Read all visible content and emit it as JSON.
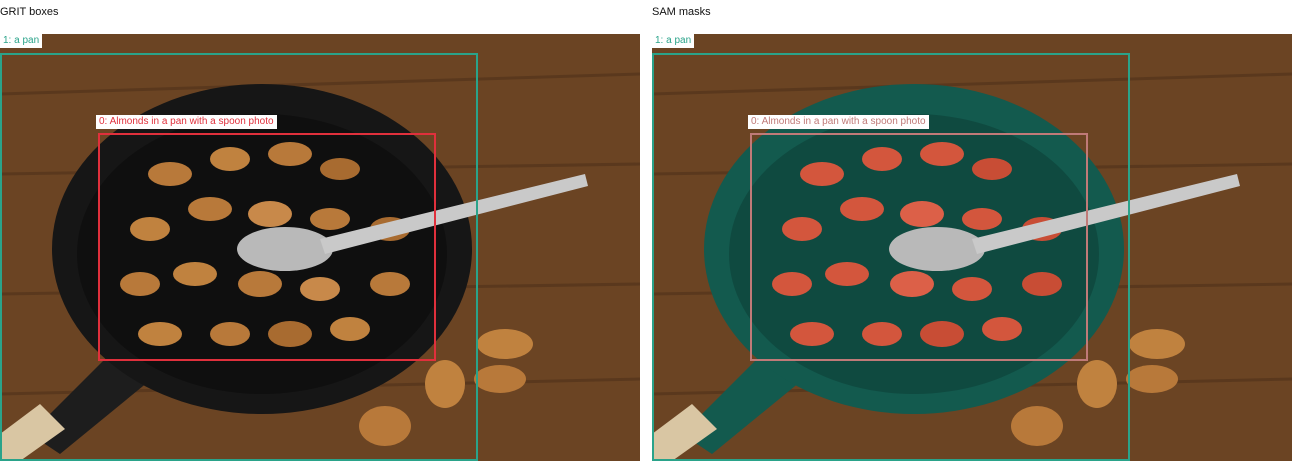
{
  "panels": [
    {
      "title": "GRIT boxes",
      "mode": "boxes",
      "annotations": [
        {
          "label": "0: Almonds in a pan with a spoon photo",
          "color": "#e0303c"
        },
        {
          "label": "1: a pan",
          "color": "#2aa38a"
        }
      ]
    },
    {
      "title": "SAM masks",
      "mode": "masks",
      "annotations": [
        {
          "label": "0: Almonds in a pan with a spoon photo",
          "color": "#c07a78"
        },
        {
          "label": "1: a pan",
          "color": "#2aa38a"
        }
      ],
      "mask_colors": {
        "pan": "#135a4e",
        "almonds": "#d3563d"
      }
    }
  ],
  "scene_colors": {
    "table": "#6b4423",
    "pan": "#161616",
    "almond": "#b8793a",
    "handle": "#d9c6a3"
  }
}
